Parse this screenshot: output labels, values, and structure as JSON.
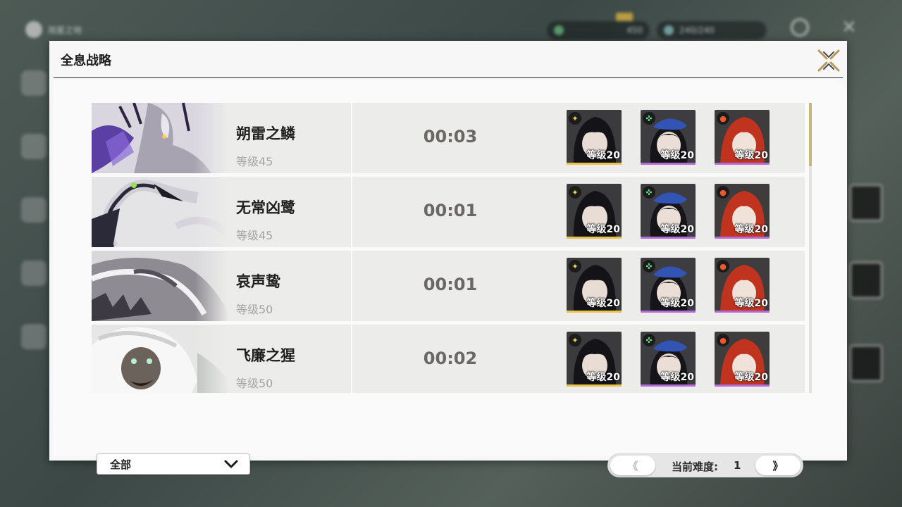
{
  "background_hud": {
    "location_label": "观星之地",
    "resource1_value": "450",
    "resource2_value": "240/240"
  },
  "panel": {
    "title": "全息战略"
  },
  "strategy_list": [
    {
      "boss_name": "朔雷之鳞",
      "boss_level": "等级45",
      "time": "00:03",
      "team": [
        {
          "level": "等级20"
        },
        {
          "level": "等级20"
        },
        {
          "level": "等级20"
        }
      ]
    },
    {
      "boss_name": "无常凶鹭",
      "boss_level": "等级45",
      "time": "00:01",
      "team": [
        {
          "level": "等级20"
        },
        {
          "level": "等级20"
        },
        {
          "level": "等级20"
        }
      ]
    },
    {
      "boss_name": "哀声鸷",
      "boss_level": "等级50",
      "time": "00:01",
      "team": [
        {
          "level": "等级20"
        },
        {
          "level": "等级20"
        },
        {
          "level": "等级20"
        }
      ]
    },
    {
      "boss_name": "飞廉之猩",
      "boss_level": "等级50",
      "time": "00:02",
      "team": [
        {
          "level": "等级20"
        },
        {
          "level": "等级20"
        },
        {
          "level": "等级20"
        }
      ]
    }
  ],
  "colors": {
    "rarity_gold": "#e9c24a",
    "rarity_purple": "#b66ad6",
    "accent_gold": "#c9b580"
  },
  "filter": {
    "selected": "全部",
    "icon": "chevron-down-icon"
  },
  "pagination": {
    "prev_label": "《",
    "next_label": "》",
    "difficulty_label": "当前难度:",
    "difficulty_value": "1"
  }
}
